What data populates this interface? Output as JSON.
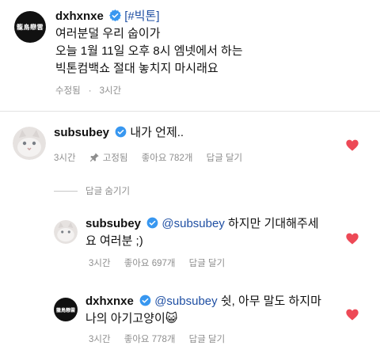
{
  "post": {
    "avatar_text": "籠鳥戀雲",
    "username": "dxhxnxe",
    "hashtag": "[#빅톤]",
    "lines": [
      "여러분덜 우리 숩이가",
      "오늘 1월 11일 오후 8시 엠넷에서 하는",
      "빅톤컴백쇼 절대 놓치지 마시래요"
    ],
    "edited_label": "수정됨",
    "time": "3시간"
  },
  "comments": [
    {
      "username": "subsubey",
      "text": "내가 언제..",
      "time": "3시간",
      "pinned_label": "고정됨",
      "likes": "좋아요 782개",
      "reply_label": "답글 달기"
    }
  ],
  "hide_replies_label": "답글 숨기기",
  "replies": [
    {
      "username": "subsubey",
      "mention": "@subsubey",
      "text_line1": " 하지만 기대해주세",
      "text_line2": "요 여러분 ;)",
      "time": "3시간",
      "likes": "좋아요 697개",
      "reply_label": "답글 달기"
    },
    {
      "avatar_text": "籠鳥戀雲",
      "username": "dxhxnxe",
      "mention": "@subsubey",
      "text_line1": " 쉿, 아무 말도 하지마",
      "text_line2": "나의 아기고양이😺",
      "time": "3시간",
      "likes": "좋아요 778개",
      "reply_label": "답글 달기"
    }
  ],
  "colors": {
    "link": "#1f4fa3",
    "heart": "#ed4956",
    "verified": "#3897f0",
    "meta": "#8e8e8e"
  },
  "icons": [
    "verified-badge-icon",
    "pin-icon",
    "heart-icon",
    "cat-avatar"
  ]
}
